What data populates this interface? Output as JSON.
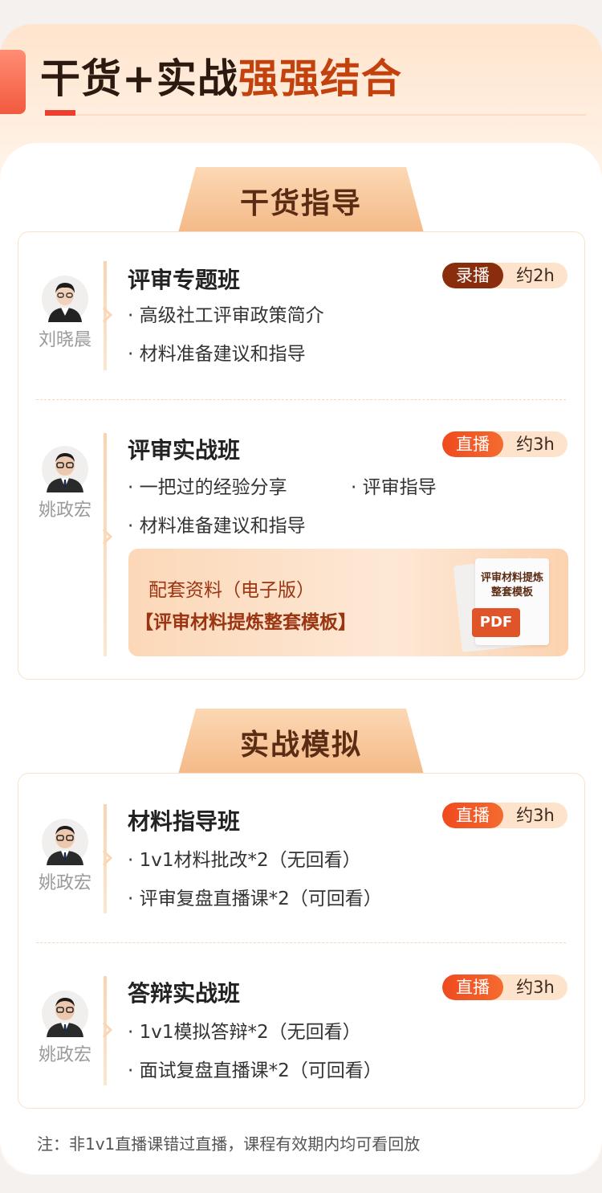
{
  "header": {
    "title_part1": "干货+实战",
    "title_part2": "强强结合"
  },
  "sections": [
    {
      "tab_label": "干货指导",
      "courses": [
        {
          "teacher": "刘晓晨",
          "title": "评审专题班",
          "badge_type": "录播",
          "duration": "约2h",
          "bullets": [
            "· 高级社工评审政策简介",
            "· 材料准备建议和指导"
          ]
        },
        {
          "teacher": "姚政宏",
          "title": "评审实战班",
          "badge_type": "直播",
          "duration": "约3h",
          "bullets": [
            "· 一把过的经验分享",
            "· 评审指导",
            "· 材料准备建议和指导"
          ],
          "promo": {
            "line1": "配套资料（电子版）",
            "line2": "【评审材料提炼整套模板】",
            "doc_title": "评审材料提炼整套模板",
            "doc_tag": "PDF"
          }
        }
      ]
    },
    {
      "tab_label": "实战模拟",
      "courses": [
        {
          "teacher": "姚政宏",
          "title": "材料指导班",
          "badge_type": "直播",
          "duration": "约3h",
          "bullets": [
            "· 1v1材料批改*2（无回看）",
            "· 评审复盘直播课*2（可回看）"
          ]
        },
        {
          "teacher": "姚政宏",
          "title": "答辩实战班",
          "badge_type": "直播",
          "duration": "约3h",
          "bullets": [
            "· 1v1模拟答辩*2（无回看）",
            "· 面试复盘直播课*2（可回看）"
          ]
        }
      ]
    }
  ],
  "note": "注：非1v1直播课错过直播，课程有效期内均可看回放",
  "colors": {
    "accent_red": "#ee3f2e",
    "title_brown": "#c2410c",
    "record_badge": "#8a2d0d",
    "live_badge": "#ef4a1f"
  }
}
